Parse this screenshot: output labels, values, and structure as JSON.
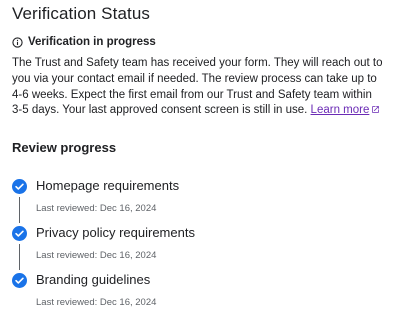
{
  "header": {
    "title": "Verification Status"
  },
  "status": {
    "icon": "info-icon",
    "label": "Verification in progress"
  },
  "description": {
    "text": "The Trust and Safety team has received your form. They will reach out to you via your contact email if needed. The review process can take up to 4-6 weeks. Expect the first email from our Trust and Safety team within 3-5 days. Your last approved consent screen is still in use.",
    "link_label": "Learn more",
    "link_icon": "external-link-icon"
  },
  "review": {
    "title": "Review progress",
    "steps": [
      {
        "label": "Homepage requirements",
        "sub": "Last reviewed: Dec 16, 2024",
        "state": "complete"
      },
      {
        "label": "Privacy policy requirements",
        "sub": "Last reviewed: Dec 16, 2024",
        "state": "complete"
      },
      {
        "label": "Branding guidelines",
        "sub": "Last reviewed: Dec 16, 2024",
        "state": "complete"
      }
    ]
  },
  "colors": {
    "check": "#1a73e8",
    "link": "#6b2bb5",
    "connector": "#5f6368"
  }
}
